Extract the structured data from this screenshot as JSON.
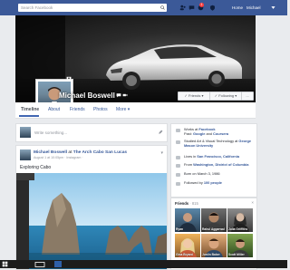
{
  "topbar": {
    "search_placeholder": "Search Facebook",
    "nav_home": "Home",
    "nav_user": "Michael",
    "notification_count": "1"
  },
  "profile": {
    "name": "Michael Boswell",
    "friends_button": "Friends",
    "following_button": "Following",
    "more_button": "..."
  },
  "tabs": [
    {
      "label": "Timeline"
    },
    {
      "label": "About"
    },
    {
      "label": "Friends"
    },
    {
      "label": "Photos"
    },
    {
      "label": "More"
    }
  ],
  "composer": {
    "placeholder": "Write something..."
  },
  "post": {
    "author": "Michael Boswell",
    "connector": "at",
    "place": "The Arch Cabo San Lucas",
    "meta": "August 1 at 10:05pm · Instagram ·",
    "text": "Exploring Cabo"
  },
  "intro": [
    {
      "pre": "Works at ",
      "bold": "Facebook",
      "post": "",
      "line2_pre": "Past: ",
      "line2_bold": "Google",
      "line2_mid": " and ",
      "line2_bold2": "Coursera"
    },
    {
      "pre": "Studied Art & Visual Technology at ",
      "bold": "George Mason University",
      "post": ""
    },
    {
      "pre": "Lives in ",
      "bold": "San Francisco, California",
      "post": ""
    },
    {
      "pre": "From ",
      "bold": "Washington, District of Columbia",
      "post": ""
    },
    {
      "pre": "Born on March 3, 1986",
      "bold": "",
      "post": ""
    },
    {
      "pre": "Followed by ",
      "bold": "100 people",
      "post": ""
    }
  ],
  "friends": {
    "title": "Friends",
    "count": "· 815",
    "close": "×",
    "people": [
      {
        "name": "Ryan"
      },
      {
        "name": "Rahul Aggarwal"
      },
      {
        "name": "Julia Griffiths"
      },
      {
        "name": "Gina Bryant"
      },
      {
        "name": "Justin Baker"
      },
      {
        "name": "Scott Miller"
      }
    ]
  }
}
